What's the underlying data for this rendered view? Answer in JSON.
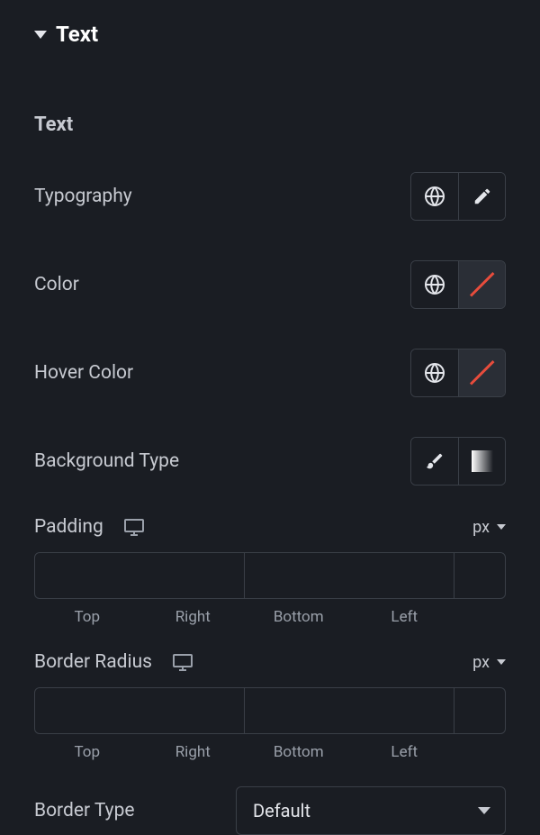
{
  "section": {
    "title": "Text"
  },
  "subsection": {
    "title": "Text"
  },
  "controls": {
    "typography": {
      "label": "Typography"
    },
    "color": {
      "label": "Color"
    },
    "hover_color": {
      "label": "Hover Color"
    },
    "background_type": {
      "label": "Background Type"
    }
  },
  "padding": {
    "label": "Padding",
    "unit": "px",
    "sides": {
      "top": "Top",
      "right": "Right",
      "bottom": "Bottom",
      "left": "Left"
    }
  },
  "border_radius": {
    "label": "Border Radius",
    "unit": "px",
    "sides": {
      "top": "Top",
      "right": "Right",
      "bottom": "Bottom",
      "left": "Left"
    }
  },
  "border_type": {
    "label": "Border Type",
    "value": "Default"
  }
}
